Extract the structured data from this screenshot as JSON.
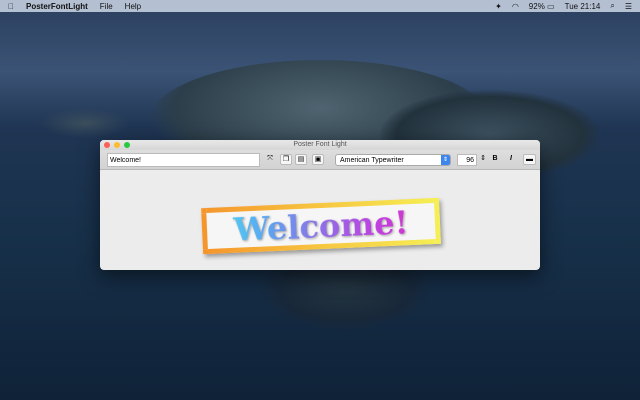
{
  "menubar": {
    "app": "PosterFontLight",
    "items": [
      "File",
      "Help"
    ],
    "battery": "92%",
    "clock": "Tue 21:14"
  },
  "window": {
    "title": "Poster Font Light"
  },
  "toolbar": {
    "text_value": "Welcome!",
    "font": "American Typewriter",
    "size": "96",
    "bold": "B",
    "italic": "I"
  },
  "poster": {
    "text": "Welcome!",
    "colors": [
      "#4fe0f0",
      "#e030c0"
    ],
    "frame_colors": [
      "#f5962d",
      "#f5ee55"
    ]
  }
}
